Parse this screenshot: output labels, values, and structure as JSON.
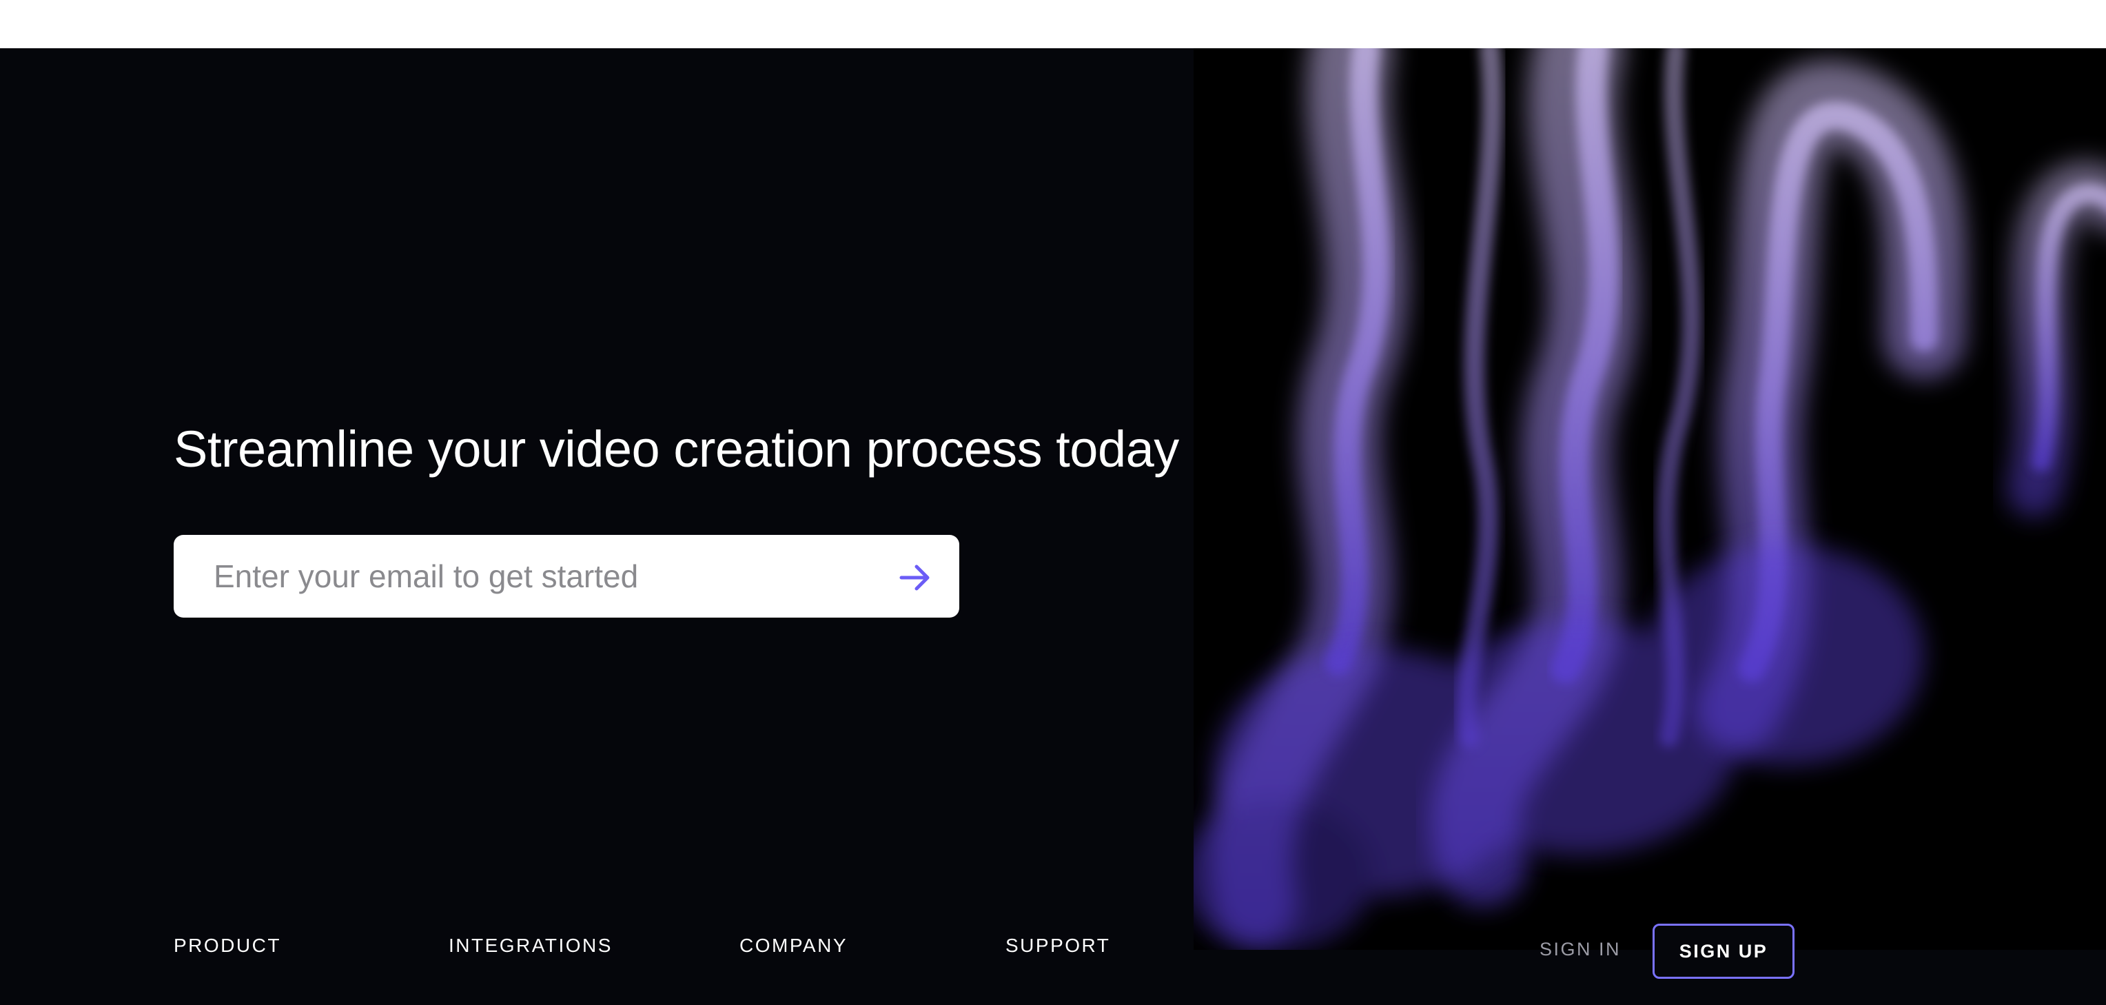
{
  "hero": {
    "headline": "Streamline your video creation process today"
  },
  "signup_form": {
    "email_placeholder": "Enter your email to get started",
    "submit_icon": "arrow-right-icon",
    "accent_color": "#6b5cf6"
  },
  "footer_nav": {
    "links": [
      {
        "label": "PRODUCT"
      },
      {
        "label": "INTEGRATIONS"
      },
      {
        "label": "COMPANY"
      },
      {
        "label": "SUPPORT"
      }
    ]
  },
  "auth": {
    "sign_in": "SIGN IN",
    "sign_up": "SIGN UP",
    "sign_up_border_color": "#7a72ff"
  },
  "colors": {
    "background": "#05060b",
    "art_background": "#000000",
    "smoke_light": "#c4b2ec",
    "smoke_dark": "#6a4fe0"
  }
}
